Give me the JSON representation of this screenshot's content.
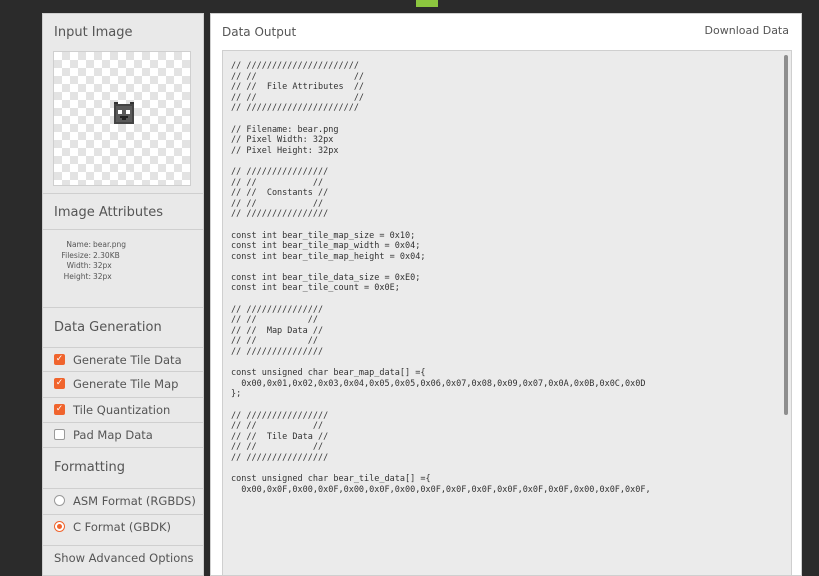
{
  "sidebar": {
    "input_title": "Input Image",
    "attributes_title": "Image Attributes",
    "attributes": [
      {
        "key": "Name:",
        "value": "bear.png"
      },
      {
        "key": "Filesize:",
        "value": "2.30KB"
      },
      {
        "key": "Width:",
        "value": "32px"
      },
      {
        "key": "Height:",
        "value": "32px"
      }
    ],
    "generation_title": "Data Generation",
    "generation_options": [
      {
        "label": "Generate Tile Data",
        "checked": true
      },
      {
        "label": "Generate Tile Map",
        "checked": true
      },
      {
        "label": "Tile Quantization",
        "checked": true
      },
      {
        "label": "Pad Map Data",
        "checked": false
      }
    ],
    "formatting_title": "Formatting",
    "format_options": [
      {
        "label": "ASM Format (RGBDS)",
        "selected": false
      },
      {
        "label": "C Format (GBDK)",
        "selected": true
      }
    ],
    "advanced_label": "Show Advanced Options"
  },
  "main": {
    "title": "Data Output",
    "download_label": "Download Data",
    "code": "// //////////////////////\n// //                   //\n// //  File Attributes  //\n// //                   //\n// //////////////////////\n\n// Filename: bear.png\n// Pixel Width: 32px\n// Pixel Height: 32px\n\n// ////////////////\n// //           //\n// //  Constants //\n// //           //\n// ////////////////\n\nconst int bear_tile_map_size = 0x10;\nconst int bear_tile_map_width = 0x04;\nconst int bear_tile_map_height = 0x04;\n\nconst int bear_tile_data_size = 0xE0;\nconst int bear_tile_count = 0x0E;\n\n// ///////////////\n// //          //\n// //  Map Data //\n// //          //\n// ///////////////\n\nconst unsigned char bear_map_data[] ={\n  0x00,0x01,0x02,0x03,0x04,0x05,0x05,0x06,0x07,0x08,0x09,0x07,0x0A,0x0B,0x0C,0x0D\n};\n\n// ////////////////\n// //           //\n// //  Tile Data //\n// //           //\n// ////////////////\n\nconst unsigned char bear_tile_data[] ={\n  0x00,0x0F,0x00,0x0F,0x00,0x0F,0x00,0x0F,0x0F,0x0F,0x0F,0x0F,0x0F,0x00,0x0F,0x0F,"
  },
  "colors": {
    "accent_orange": "#f0642d",
    "accent_green": "#8cc63f",
    "background": "#2b2b2b"
  }
}
